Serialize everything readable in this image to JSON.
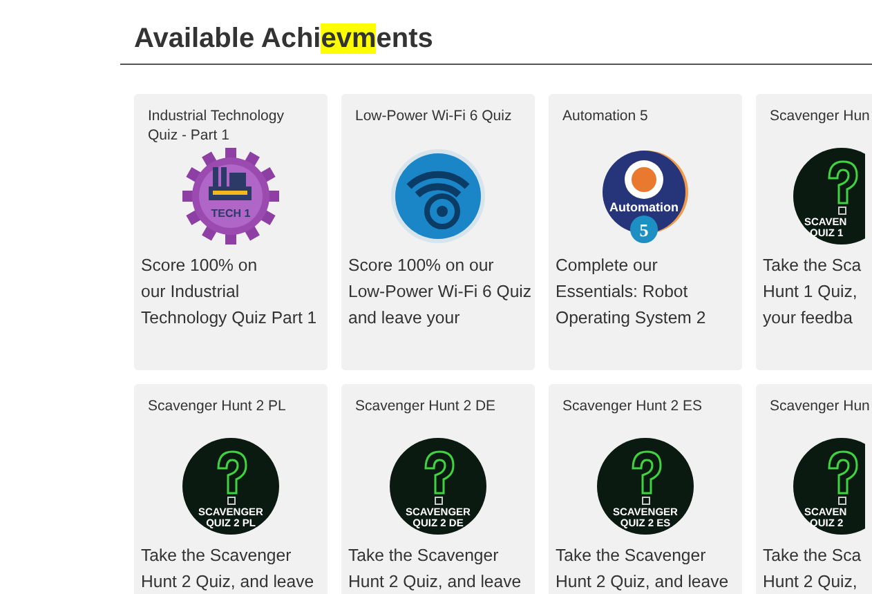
{
  "heading": {
    "parts": [
      {
        "text": "Available Achi",
        "highlighted": false
      },
      {
        "text": "evm",
        "highlighted": true
      },
      {
        "text": "ents",
        "highlighted": false
      }
    ]
  },
  "rows": [
    {
      "cards": [
        {
          "title": "Industrial Technology Quiz - Part 1",
          "badge": {
            "kind": "gear",
            "lines": [
              "TECH 1"
            ]
          },
          "description_lines": [
            "Score 100% on",
            "our Industrial",
            "Technology Quiz Part 1"
          ],
          "cut": false
        },
        {
          "title": "Low-Power Wi-Fi 6 Quiz",
          "badge": {
            "kind": "wifi"
          },
          "description_lines": [
            "Score 100% on our",
            "Low-Power Wi-Fi 6 Quiz",
            "and leave your"
          ],
          "cut": false
        },
        {
          "title": "Automation 5",
          "badge": {
            "kind": "automation",
            "lines": [
              "Automation",
              "5"
            ]
          },
          "description_lines": [
            "Complete our",
            "Essentials: Robot",
            "Operating System 2"
          ],
          "cut": false
        },
        {
          "title": "Scavenger Hun",
          "badge": {
            "kind": "scavenger",
            "lines": [
              "SCAVEN",
              "QUIZ 1"
            ]
          },
          "description_lines": [
            "Take the Sca",
            "Hunt 1 Quiz,",
            "your feedba"
          ],
          "cut": true
        }
      ]
    },
    {
      "cards": [
        {
          "title": "Scavenger Hunt 2 PL",
          "badge": {
            "kind": "scavenger",
            "lines": [
              "SCAVENGER",
              "QUIZ 2 PL"
            ]
          },
          "description_lines": [
            "Take the Scavenger",
            "Hunt 2 Quiz, and leave"
          ],
          "cut": false
        },
        {
          "title": "Scavenger Hunt 2 DE",
          "badge": {
            "kind": "scavenger",
            "lines": [
              "SCAVENGER",
              "QUIZ 2 DE"
            ]
          },
          "description_lines": [
            "Take the Scavenger",
            "Hunt 2 Quiz, and leave"
          ],
          "cut": false
        },
        {
          "title": "Scavenger Hunt 2 ES",
          "badge": {
            "kind": "scavenger",
            "lines": [
              "SCAVENGER",
              "QUIZ 2 ES"
            ]
          },
          "description_lines": [
            "Take the Scavenger",
            "Hunt 2 Quiz, and leave"
          ],
          "cut": false
        },
        {
          "title": "Scavenger Hun",
          "badge": {
            "kind": "scavenger",
            "lines": [
              "SCAVEN",
              "QUIZ 2"
            ]
          },
          "description_lines": [
            "Take the Sca",
            "Hunt 2 Quiz,"
          ],
          "cut": true
        }
      ]
    }
  ]
}
